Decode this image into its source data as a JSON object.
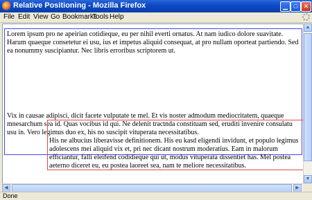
{
  "window": {
    "title": "Relative Positioning - Mozilla Firefox"
  },
  "menu": [
    "File",
    "Edit",
    "View",
    "Go",
    "Bookmarks",
    "Tools",
    "Help"
  ],
  "content": {
    "box1_p1": "Lorem ipsum pro ne apeirian cotidieque, eu per nihil everti ornatus. At nam iudico dolore suavitate. Harum quaeque consetetur ei usu, ius et impetus aliquid consequat, at pro nullam oporteat partiendo. Sed ea nonummy suscipiantur. Nec libris erroribus scriptorem ut.",
    "box1_p2": "Vix in causae adipisci, dicit facete vulputate te mel. Et vis noster admodum mediocritatem, quaeque mnesarchum sea id. Quas vocibus id qui. Ne delenit tractnda constituam sed, eruditi invenire consulatu usu in. Vero legimus duo ex, his no suscipit vituperata necessitatibus.",
    "box2_p": "His ne albucius liberavisse definitionem. His eu kasd eligendi invidunt, et populo legimus adolescens mei aliquid vix et, pri nec dicant nostrum moderatius. Eam in malorum efficiantur, falli eleifend codidieque qui ut, modus vituperata dissentiet has. Mel postea aeterno diceret eu, eu postea laoreet sea, nam te meliore necessitatibus."
  },
  "statusbar": {
    "text": "Done"
  }
}
